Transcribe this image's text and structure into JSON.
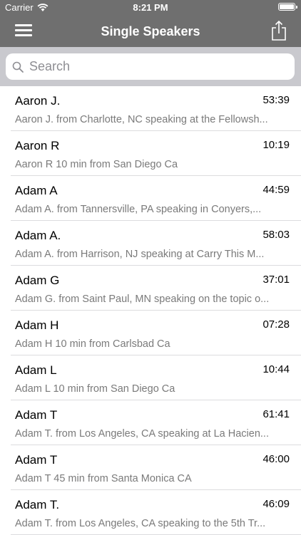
{
  "status_bar": {
    "carrier": "Carrier",
    "time": "8:21 PM"
  },
  "nav": {
    "title": "Single Speakers"
  },
  "search": {
    "placeholder": "Search"
  },
  "speakers": [
    {
      "name": "Aaron J.",
      "duration": "53:39",
      "description": "Aaron J. from Charlotte, NC speaking at the Fellowsh..."
    },
    {
      "name": "Aaron R",
      "duration": "10:19",
      "description": "Aaron R 10 min from San Diego Ca"
    },
    {
      "name": "Adam A",
      "duration": "44:59",
      "description": "Adam A. from Tannersville, PA speaking in Conyers,..."
    },
    {
      "name": "Adam A.",
      "duration": "58:03",
      "description": "Adam A. from Harrison, NJ speaking at Carry This M..."
    },
    {
      "name": "Adam G",
      "duration": "37:01",
      "description": "Adam G. from Saint Paul, MN speaking on the topic o..."
    },
    {
      "name": "Adam H",
      "duration": "07:28",
      "description": "Adam H 10 min from Carlsbad Ca"
    },
    {
      "name": "Adam L",
      "duration": "10:44",
      "description": "Adam L 10 min from San Diego Ca"
    },
    {
      "name": "Adam T",
      "duration": "61:41",
      "description": "Adam T. from Los Angeles, CA speaking at La Hacien..."
    },
    {
      "name": "Adam T",
      "duration": "46:00",
      "description": "Adam T 45 min from Santa Monica CA"
    },
    {
      "name": "Adam T.",
      "duration": "46:09",
      "description": "Adam T. from Los Angeles, CA speaking to the 5th Tr..."
    }
  ]
}
